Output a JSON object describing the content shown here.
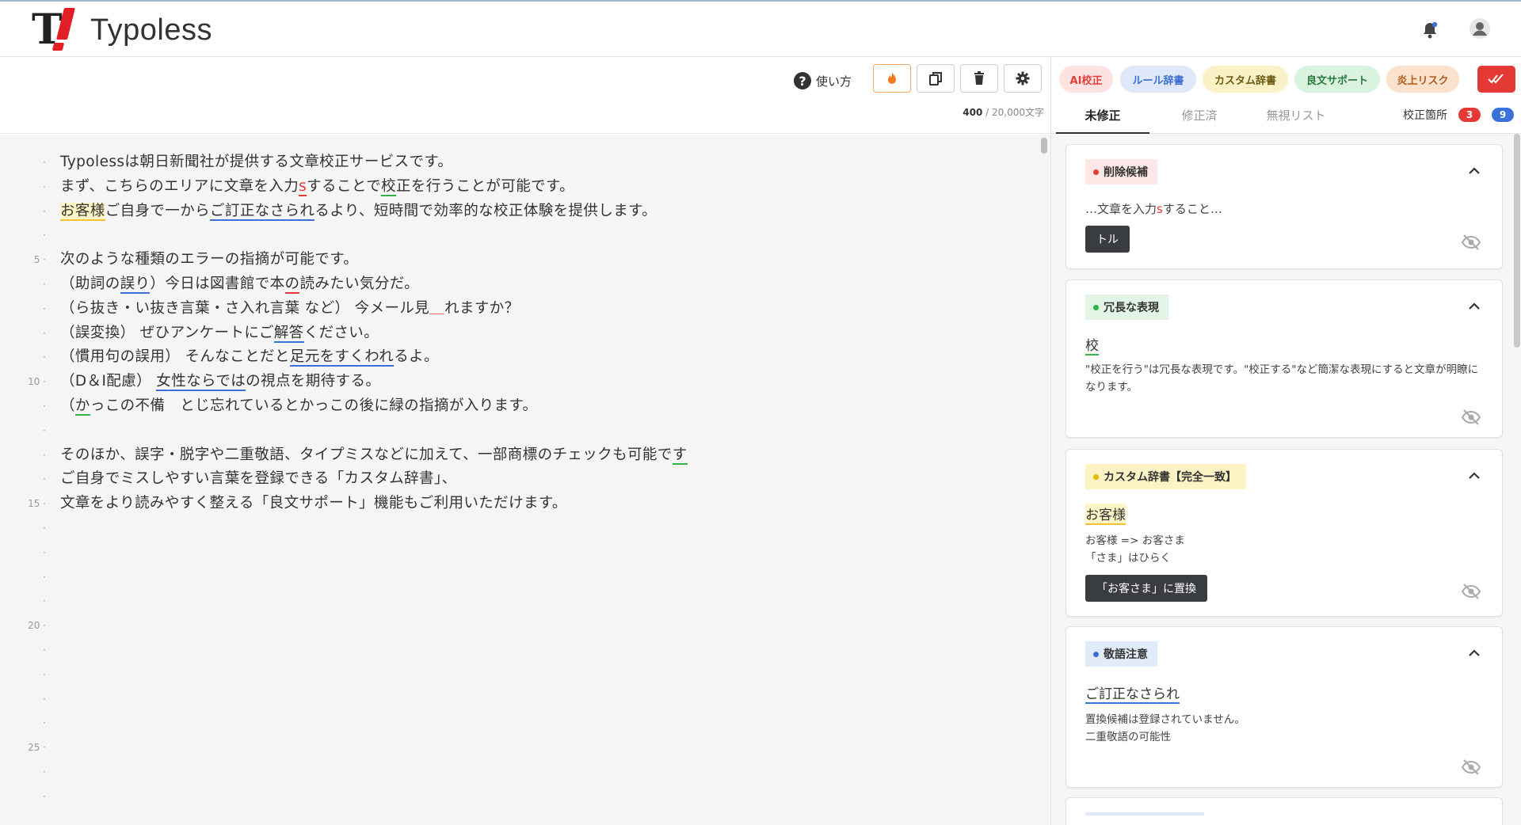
{
  "header": {
    "logo_text": "Typoless",
    "logo_letter": "T"
  },
  "toolbar": {
    "help_label": "使い方",
    "char_count_current": "400",
    "char_count_max": " / 20,000文字"
  },
  "editor": {
    "gutter_labels": [
      {
        "line": 5,
        "label": "5"
      },
      {
        "line": 10,
        "label": "10"
      },
      {
        "line": 15,
        "label": "15"
      },
      {
        "line": 20,
        "label": "20"
      },
      {
        "line": 25,
        "label": "25"
      }
    ],
    "total_lines": 27,
    "line1": "Typolessは朝日新聞社が提供する文章校正サービスです。",
    "line2": {
      "a": "まず、こちらのエリアに文章を入力",
      "b": "s",
      "c": "することで",
      "d": "校",
      "e": "正を行うことが可能です。"
    },
    "line3": {
      "a": "お客様",
      "b": "ご自身で一から",
      "c": "ご訂正なさられ",
      "d": "るより、短時間で効率的な校正体験を提供します。"
    },
    "line5": "次のような種類のエラーの指摘が可能です。",
    "line6": {
      "a": "（助詞の",
      "b": "誤り",
      "c": "）今日は図書館で本",
      "d": "の",
      "e": "読みたい気分だ。"
    },
    "line7": {
      "a": "（ら抜き・い抜き言葉・さ入れ言葉 など） 今メール見",
      "b": "＿",
      "c": "れますか？"
    },
    "line8": {
      "a": "（誤変換） ぜひアンケートにご",
      "b": "解答",
      "c": "ください。"
    },
    "line9": {
      "a": "（慣用句の誤用） そんなことだと",
      "b": "足元をすくわれ",
      "c": "るよ。"
    },
    "line10": {
      "a": "（D＆I配慮） ",
      "b": "女性ならでは",
      "c": "の視点を期待する。"
    },
    "line11": {
      "a": "（",
      "b": "か",
      "c": "っこの不備　とじ忘れているとかっこの後に緑の指摘が入ります。"
    },
    "line13": {
      "a": "そのほか、誤字・脱字や二重敬語、タイプミスなどに加えて、一部商標のチェックも可能で",
      "b": "す"
    },
    "line14": "ご自身でミスしやすい言葉を登録できる「カスタム辞書」、",
    "line15": "文章をより読みやすく整える「良文サポート」機能もご利用いただけます。"
  },
  "panel": {
    "pills": {
      "ai": "AI校正",
      "rule": "ルール辞書",
      "custom": "カスタム辞書",
      "good": "良文サポート",
      "fire": "炎上リスク"
    },
    "tabs": {
      "unfixed": "未修正",
      "fixed": "修正済",
      "ignore": "無視リスト"
    },
    "fix_label": "校正箇所",
    "count_red": "3",
    "count_blue": "9",
    "cards": {
      "delete": {
        "tag": "削除候補",
        "snippet_a": "…文章を入力",
        "snippet_b": "s",
        "snippet_c": "すること…",
        "button": "トル"
      },
      "redundant": {
        "tag": "冗長な表現",
        "word": "校",
        "desc": "\"校正を行う\"は冗長な表現です。\"校正する\"など簡潔な表現にすると文章が明瞭になります。"
      },
      "custom": {
        "tag": "カスタム辞書【完全一致】",
        "word": "お客様",
        "desc1": "お客様 => お客さま",
        "desc2": "「さま」はひらく",
        "button": "「お客さま」に置換"
      },
      "honorific": {
        "tag": "敬語注意",
        "word": "ご訂正なさられ",
        "desc1": "置換候補は登録されていません。",
        "desc2": "二重敬語の可能性"
      }
    }
  },
  "colors": {
    "accent_red": "#e53935",
    "accent_blue": "#3b72d9",
    "accent_green": "#2fb44a",
    "accent_yellow": "#f2c233"
  }
}
